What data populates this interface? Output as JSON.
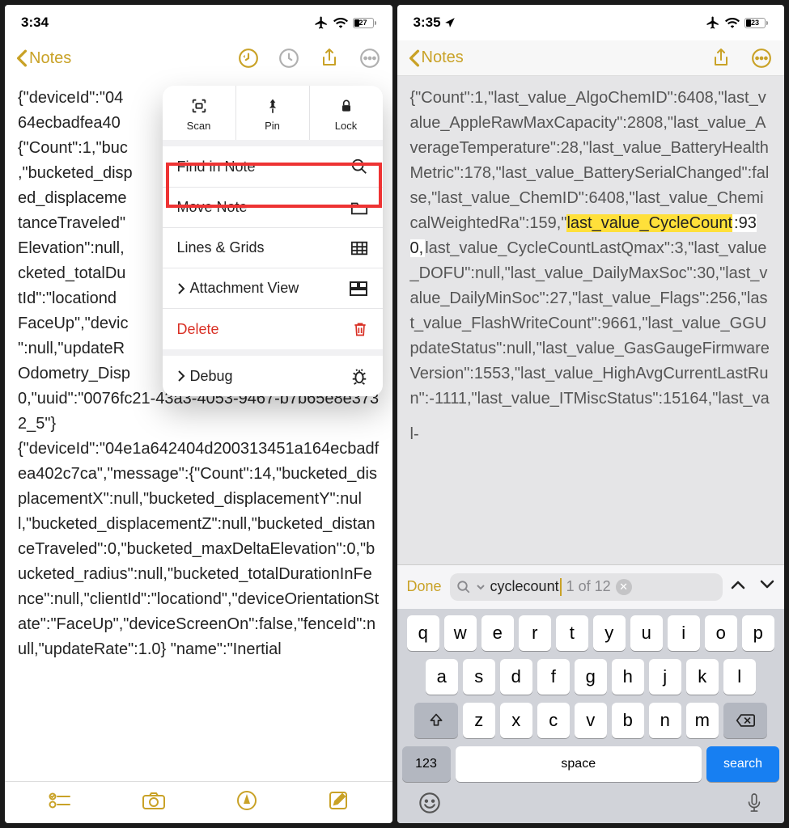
{
  "left": {
    "status": {
      "time": "3:34",
      "battery": "27"
    },
    "nav": {
      "back": "Notes"
    },
    "popover": {
      "top": {
        "scan": "Scan",
        "pin": "Pin",
        "lock": "Lock"
      },
      "find": "Find in Note",
      "move": "Move Note",
      "lines": "Lines & Grids",
      "attach": "Attachment View",
      "delete": "Delete",
      "debug": "Debug"
    },
    "body": "{\"deviceId\":\"04\n64ecbadfea40\n{\"Count\":1,\"buc\n,\"bucketed_disp\ned_displaceme\ntanceTraveled\"\nElevation\":null,\ncketed_totalDu\ntId\":\"locationd\nFaceUp\",\"devic\n\":null,\"updateR\nOdometry_Disp\n0,\"uuid\":\"0076fc21-43a3-4053-9467-b7b65e8e3732_5\"}\n{\"deviceId\":\"04e1a642404d200313451a164ecbadfea402c7ca\",\"message\":{\"Count\":14,\"bucketed_displacementX\":null,\"bucketed_displacementY\":null,\"bucketed_displacementZ\":null,\"bucketed_distanceTraveled\":0,\"bucketed_maxDeltaElevation\":0,\"bucketed_radius\":null,\"bucketed_totalDurationInFence\":null,\"clientId\":\"locationd\",\"deviceOrientationState\":\"FaceUp\",\"deviceScreenOn\":false,\"fenceId\":null,\"updateRate\":1.0} \"name\":\"Inertial"
  },
  "right": {
    "status": {
      "time": "3:35",
      "battery": "23"
    },
    "nav": {
      "back": "Notes"
    },
    "body_pre": "{\"Count\":1,\"last_value_AlgoChemID\":6408,\"last_value_AppleRawMaxCapacity\":2808,\"last_value_AverageTemperature\":28,\"last_value_BatteryHealthMetric\":178,\"last_value_BatterySerialChanged\":false,\"last_value_ChemID\":6408,\"last_value_ChemicalWeightedRa\":159,\"",
    "body_hi": "last_value_CycleCount",
    "body_930": ":930,",
    "body_post": "last_value_CycleCountLastQmax\":3,\"last_value_DOFU\":null,\"last_value_DailyMaxSoc\":30,\"last_value_DailyMinSoc\":27,\"last_value_Flags\":256,\"last_value_FlashWriteCount\":9661,\"last_value_GGUpdateStatus\":null,\"last_value_GasGaugeFirmwareVersion\":1553,\"last_value_HighAvgCurrentLastRun\":-1111,\"last_value_ITMiscStatus\":15164,\"last_val-",
    "find": {
      "done": "Done",
      "query": "cyclecount",
      "count": "1 of 12"
    },
    "keyboard": {
      "row1": [
        "q",
        "w",
        "e",
        "r",
        "t",
        "y",
        "u",
        "i",
        "o",
        "p"
      ],
      "row2": [
        "a",
        "s",
        "d",
        "f",
        "g",
        "h",
        "j",
        "k",
        "l"
      ],
      "row3": [
        "z",
        "x",
        "c",
        "v",
        "b",
        "n",
        "m"
      ],
      "num": "123",
      "space": "space",
      "search": "search"
    }
  }
}
